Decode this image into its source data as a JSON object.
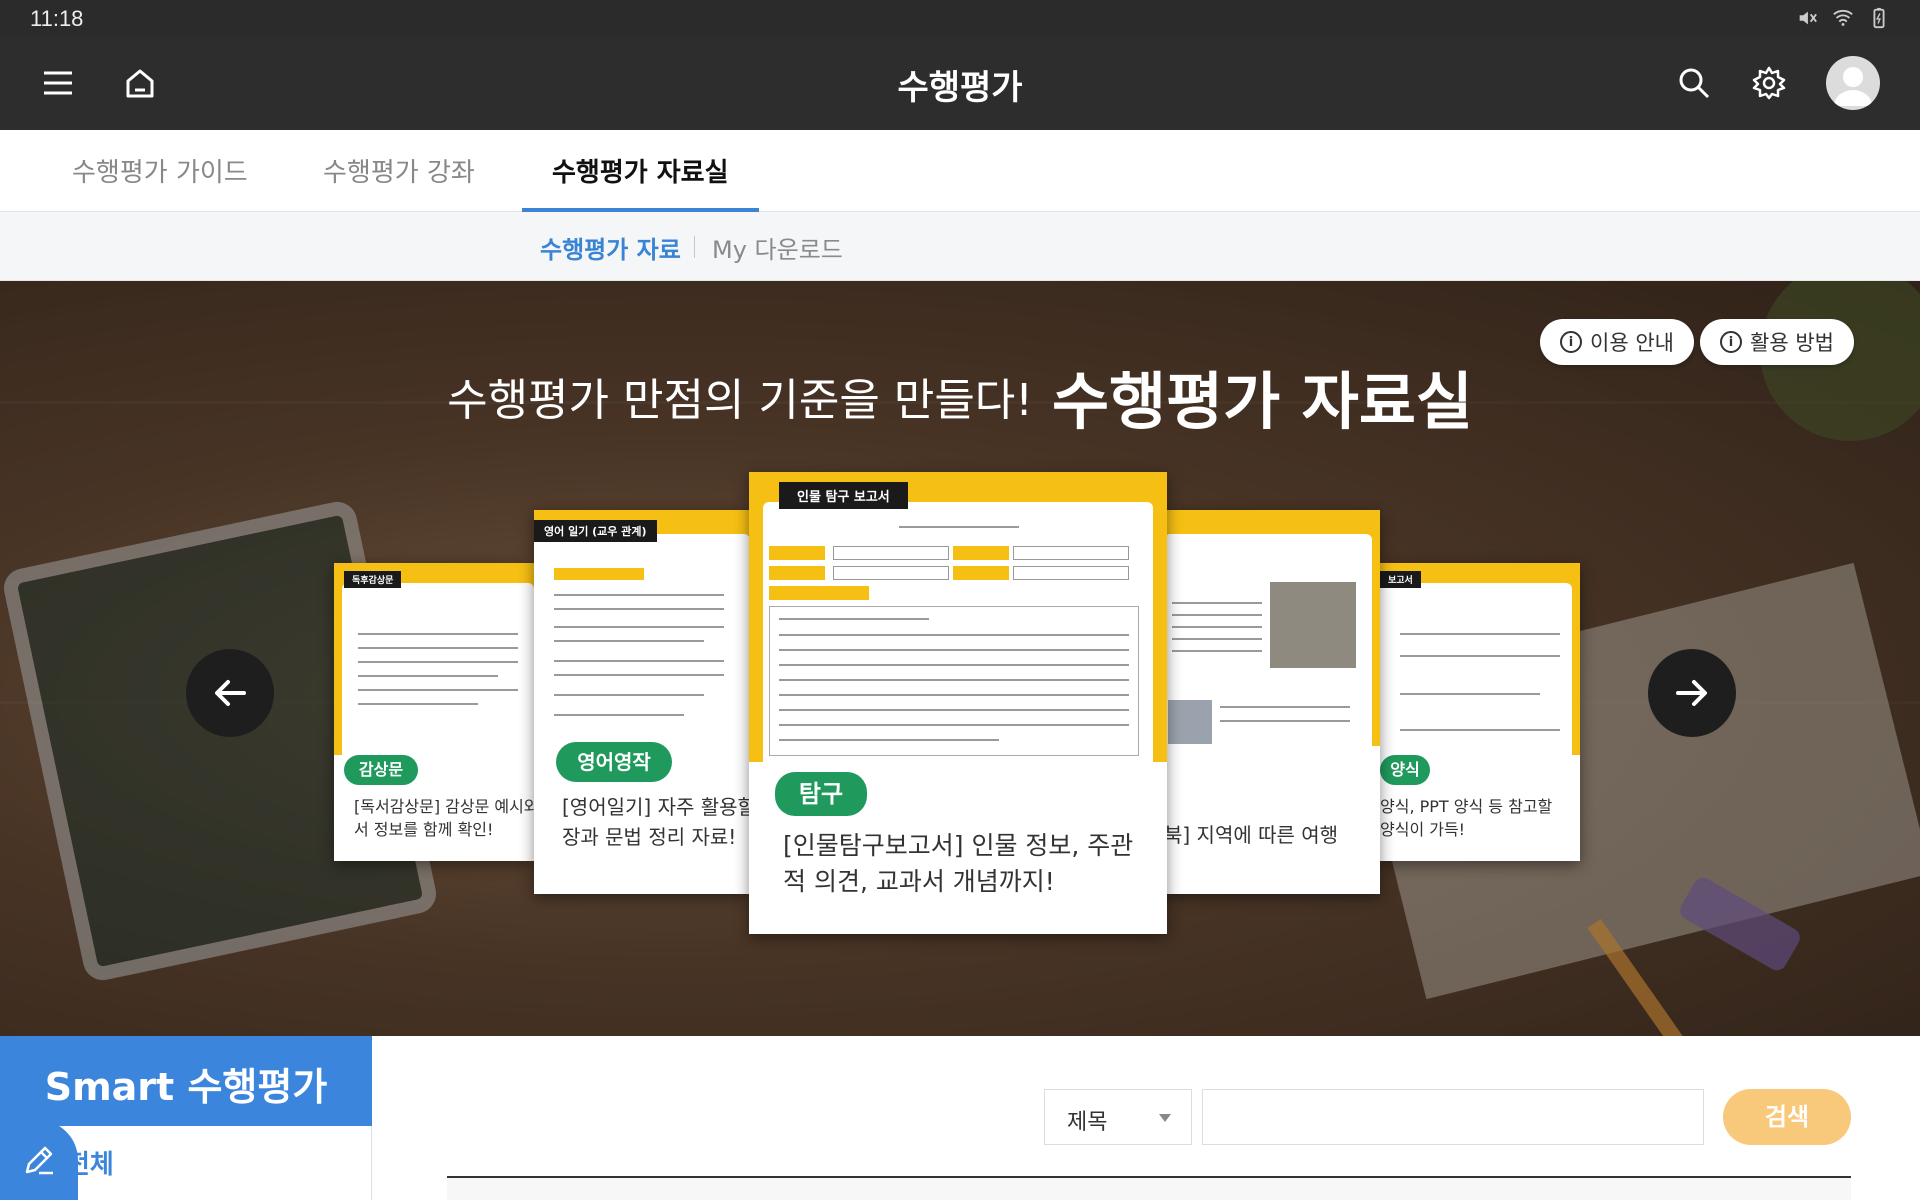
{
  "status_bar": {
    "time": "11:18",
    "icons": [
      "mute-icon",
      "wifi-icon",
      "battery-icon"
    ]
  },
  "app_bar": {
    "title": "수행평가",
    "left_icons": [
      "menu-icon",
      "home-icon"
    ],
    "right_icons": [
      "search-icon",
      "settings-icon",
      "avatar"
    ]
  },
  "tabs": [
    {
      "label": "수행평가 가이드",
      "active": false
    },
    {
      "label": "수행평가 강좌",
      "active": false
    },
    {
      "label": "수행평가 자료실",
      "active": true
    }
  ],
  "subtabs": [
    {
      "label": "수행평가 자료",
      "active": true
    },
    {
      "label": "My 다운로드",
      "active": false
    }
  ],
  "banner": {
    "headline_light": "수행평가 만점의 기준을 만들다!",
    "headline_bold": "수행평가 자료실",
    "buttons": {
      "usage_guide": "이용 안내",
      "how_to_use": "활용 방법"
    },
    "cards": [
      {
        "doc_title": "독후감상문",
        "badge": "감상문",
        "desc_line1": "[독서감상문] 감상문 예시와",
        "desc_line2": "서 정보를 함께 확인!"
      },
      {
        "doc_title": "영어 일기 (교우 관계)",
        "badge": "영어영작",
        "desc_line1": "[영어일기] 자주 활용할",
        "desc_line2": "장과 문법 정리 자료!"
      },
      {
        "doc_title": "인물 탐구 보고서",
        "badge": "탐구",
        "desc_line1": "[인물탐구보고서] 인물 정보, 주관",
        "desc_line2": "적 의견, 교과서 개념까지!"
      },
      {
        "doc_title": "",
        "badge": "",
        "desc_line1": "북] 지역에 따른 여행",
        "desc_line2": ""
      },
      {
        "doc_title": "보고서",
        "badge": "양식",
        "desc_line1": "양식, PPT 양식 등 참고할",
        "desc_line2": "양식이 가득!"
      }
    ]
  },
  "sidebar": {
    "title": "Smart 수행평가",
    "item": "전체"
  },
  "search": {
    "field_select": "제목",
    "input_value": "",
    "button": "검색"
  },
  "colors": {
    "accent_blue": "#3b86dc",
    "badge_green": "#1f9a5c",
    "card_yellow": "#f6bf13",
    "search_button": "#f9c97b",
    "app_bar": "#2d2d2d"
  }
}
